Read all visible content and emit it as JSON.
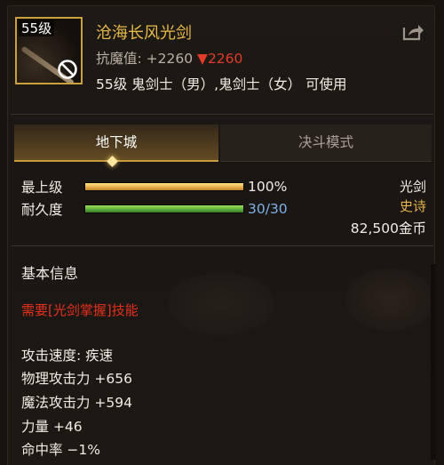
{
  "item": {
    "level_badge": "55级",
    "name": "沧海长风光剑",
    "stat_prefix": "抗魔值: +2260 ",
    "stat_drop_marker": "▼",
    "stat_drop_value": "2260",
    "usable_by": "55级 鬼剑士（男）,鬼剑士（女） 可使用",
    "icon": "lightsaber-item-icon",
    "unusable_icon": "prohibited-icon",
    "share_icon": "share-export-icon"
  },
  "tabs": [
    {
      "label": "地下城",
      "active": true
    },
    {
      "label": "决斗模式",
      "active": false
    }
  ],
  "bars": [
    {
      "label": "最上级",
      "value_text": "100%",
      "fraction": 1.0,
      "color": "#e6a94a"
    },
    {
      "label": "耐久度",
      "value_text": "30/30",
      "fraction": 1.0,
      "color": "#58a83a"
    }
  ],
  "right": {
    "type": "光剑",
    "rarity": "史诗",
    "price": "82,500金币"
  },
  "sections": {
    "basic_info_title": "基本信息",
    "requirement": "需要[光剑掌握]技能",
    "attributes": [
      "攻击速度: 疾速",
      "物理攻击力 +656",
      "魔法攻击力 +594",
      "力量 +46",
      "命中率 −1%"
    ]
  },
  "colors": {
    "title_gold": "#e7b94a",
    "rarity_epic": "#e6b64a",
    "requirement_red": "#e6301d",
    "durability_blue": "#7fb0e6",
    "stat_drop_red": "#e23b2a"
  }
}
